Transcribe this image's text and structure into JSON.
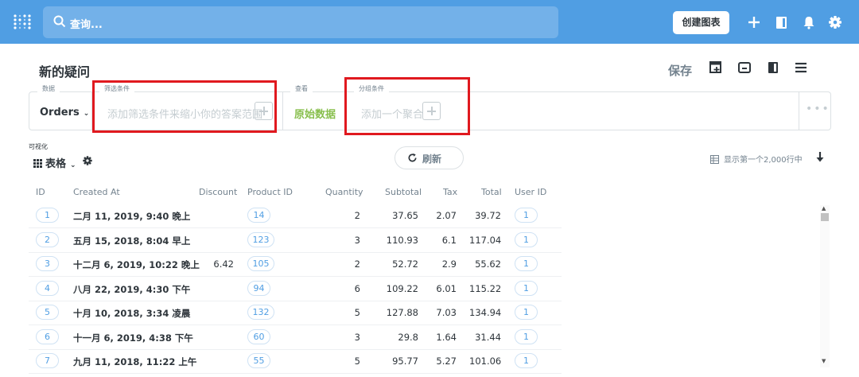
{
  "nav": {
    "search_placeholder": "查询...",
    "create_chart_label": "创建图表",
    "icons": [
      "plus-icon",
      "notebook-icon",
      "bell-icon",
      "gear-icon"
    ]
  },
  "header": {
    "title": "新的疑问",
    "save_label": "保存"
  },
  "query": {
    "data_label": "数据",
    "data_value": "Orders",
    "filter_label": "筛选条件",
    "filter_placeholder": "添加筛选条件来缩小你的答案范围",
    "view_label": "查看",
    "view_value": "原始数据",
    "group_label": "分组条件",
    "group_placeholder": "添加一个聚合",
    "more": "•••"
  },
  "viz": {
    "label": "可视化",
    "selected": "表格",
    "refresh_label": "刷新",
    "row_count": "显示第一个2,000行中"
  },
  "colors": {
    "brand": "#509ee3",
    "raw_data": "#88bf4d",
    "highlight": "#e0191f"
  },
  "table": {
    "headers": [
      "ID",
      "Created At",
      "Discount",
      "Product ID",
      "Quantity",
      "Subtotal",
      "Tax",
      "Total",
      "User ID"
    ],
    "rows": [
      {
        "id": "1",
        "created": "二月 11, 2019, 9:40 晚上",
        "discount": "",
        "product": "14",
        "qty": "2",
        "subtotal": "37.65",
        "tax": "2.07",
        "total": "39.72",
        "user": "1"
      },
      {
        "id": "2",
        "created": "五月 15, 2018, 8:04 早上",
        "discount": "",
        "product": "123",
        "qty": "3",
        "subtotal": "110.93",
        "tax": "6.1",
        "total": "117.04",
        "user": "1"
      },
      {
        "id": "3",
        "created": "十二月 6, 2019, 10:22 晚上",
        "discount": "6.42",
        "product": "105",
        "qty": "2",
        "subtotal": "52.72",
        "tax": "2.9",
        "total": "55.62",
        "user": "1"
      },
      {
        "id": "4",
        "created": "八月 22, 2019, 4:30 下午",
        "discount": "",
        "product": "94",
        "qty": "6",
        "subtotal": "109.22",
        "tax": "6.01",
        "total": "115.22",
        "user": "1"
      },
      {
        "id": "5",
        "created": "十月 10, 2018, 3:34 凌晨",
        "discount": "",
        "product": "132",
        "qty": "5",
        "subtotal": "127.88",
        "tax": "7.03",
        "total": "134.94",
        "user": "1"
      },
      {
        "id": "6",
        "created": "十一月 6, 2019, 4:38 下午",
        "discount": "",
        "product": "60",
        "qty": "3",
        "subtotal": "29.8",
        "tax": "1.64",
        "total": "31.44",
        "user": "1"
      },
      {
        "id": "7",
        "created": "九月 11, 2018, 11:22 上午",
        "discount": "",
        "product": "55",
        "qty": "5",
        "subtotal": "95.77",
        "tax": "5.27",
        "total": "101.06",
        "user": "1"
      }
    ]
  }
}
